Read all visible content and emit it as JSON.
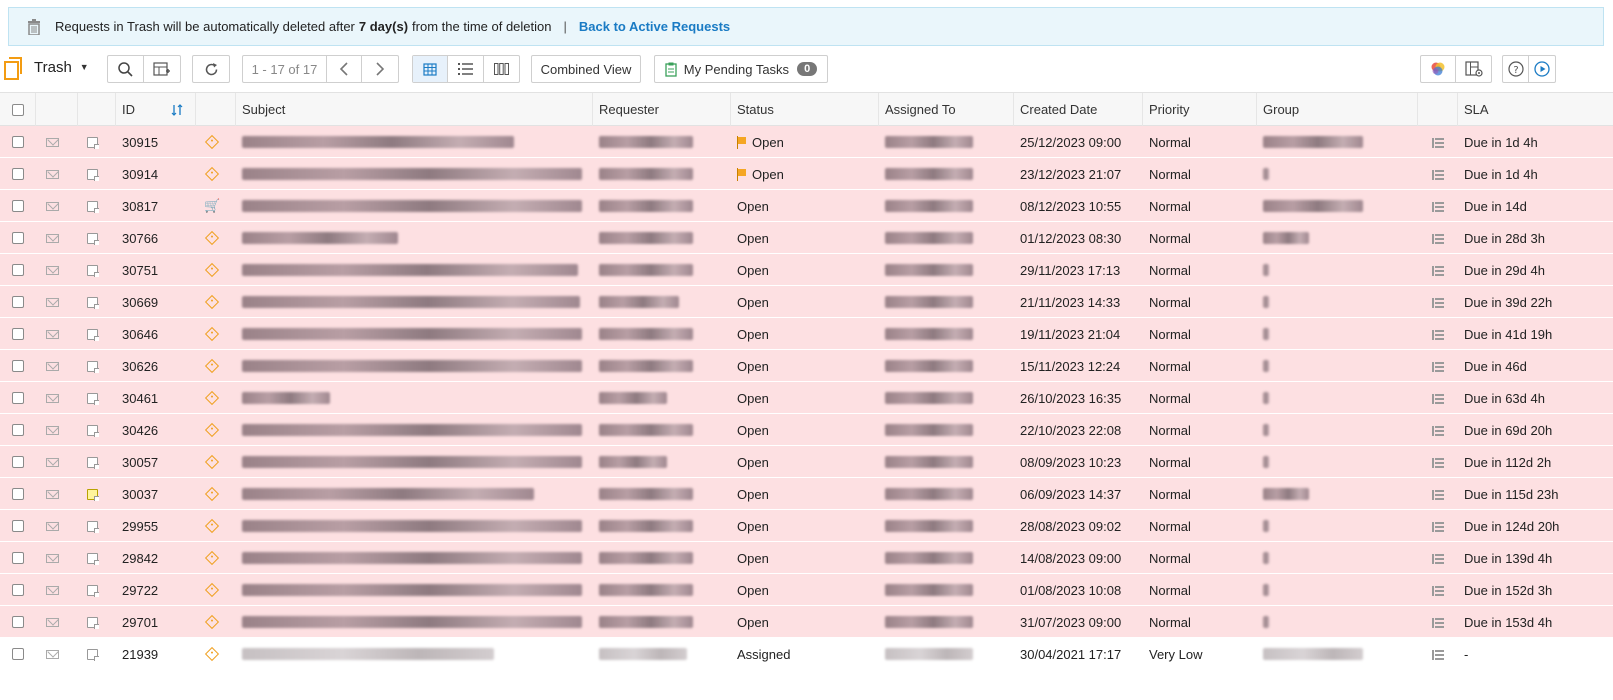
{
  "banner": {
    "prefix": "Requests in Trash will be automatically deleted after",
    "days": "7 day(s)",
    "suffix": "from the time of deletion",
    "separator": "|",
    "link": "Back to Active Requests"
  },
  "toolbar": {
    "view_name": "Trash",
    "pager": "1 - 17 of 17",
    "combined_view": "Combined View",
    "pending_tasks": "My Pending Tasks",
    "pending_count": "0"
  },
  "columns": {
    "id": "ID",
    "subject": "Subject",
    "requester": "Requester",
    "status": "Status",
    "assigned_to": "Assigned To",
    "created_date": "Created Date",
    "priority": "Priority",
    "group": "Group",
    "sla": "SLA"
  },
  "rows": [
    {
      "id": "30915",
      "status": "Open",
      "flag": true,
      "created": "25/12/2023 09:00",
      "priority": "Normal",
      "sla": "Due in 1d 4h",
      "icon": "tag",
      "note": "plain",
      "pink": true,
      "group": "wide"
    },
    {
      "id": "30914",
      "status": "Open",
      "flag": true,
      "created": "23/12/2023 21:07",
      "priority": "Normal",
      "sla": "Due in 1d 4h",
      "icon": "tag",
      "note": "plain",
      "pink": true,
      "group": "dot"
    },
    {
      "id": "30817",
      "status": "Open",
      "flag": false,
      "created": "08/12/2023 10:55",
      "priority": "Normal",
      "sla": "Due in 14d",
      "icon": "cart",
      "note": "plain",
      "pink": true,
      "group": "wide"
    },
    {
      "id": "30766",
      "status": "Open",
      "flag": false,
      "created": "01/12/2023 08:30",
      "priority": "Normal",
      "sla": "Due in 28d 3h",
      "icon": "tag",
      "note": "plain",
      "pink": true,
      "group": "short"
    },
    {
      "id": "30751",
      "status": "Open",
      "flag": false,
      "created": "29/11/2023 17:13",
      "priority": "Normal",
      "sla": "Due in 29d 4h",
      "icon": "tag",
      "note": "plain",
      "pink": true,
      "group": "dot"
    },
    {
      "id": "30669",
      "status": "Open",
      "flag": false,
      "created": "21/11/2023 14:33",
      "priority": "Normal",
      "sla": "Due in 39d 22h",
      "icon": "tag",
      "note": "plain",
      "pink": true,
      "group": "dot"
    },
    {
      "id": "30646",
      "status": "Open",
      "flag": false,
      "created": "19/11/2023 21:04",
      "priority": "Normal",
      "sla": "Due in 41d 19h",
      "icon": "tag",
      "note": "plain",
      "pink": true,
      "group": "dot"
    },
    {
      "id": "30626",
      "status": "Open",
      "flag": false,
      "created": "15/11/2023 12:24",
      "priority": "Normal",
      "sla": "Due in 46d",
      "icon": "tag",
      "note": "plain",
      "pink": true,
      "group": "dot"
    },
    {
      "id": "30461",
      "status": "Open",
      "flag": false,
      "created": "26/10/2023 16:35",
      "priority": "Normal",
      "sla": "Due in 63d 4h",
      "icon": "tag",
      "note": "plain",
      "pink": true,
      "group": "dot"
    },
    {
      "id": "30426",
      "status": "Open",
      "flag": false,
      "created": "22/10/2023 22:08",
      "priority": "Normal",
      "sla": "Due in 69d 20h",
      "icon": "tag",
      "note": "plain",
      "pink": true,
      "group": "dot"
    },
    {
      "id": "30057",
      "status": "Open",
      "flag": false,
      "created": "08/09/2023 10:23",
      "priority": "Normal",
      "sla": "Due in 112d 2h",
      "icon": "tag",
      "note": "plain",
      "pink": true,
      "group": "dot"
    },
    {
      "id": "30037",
      "status": "Open",
      "flag": false,
      "created": "06/09/2023 14:37",
      "priority": "Normal",
      "sla": "Due in 115d 23h",
      "icon": "tag",
      "note": "yellow",
      "pink": true,
      "group": "short"
    },
    {
      "id": "29955",
      "status": "Open",
      "flag": false,
      "created": "28/08/2023 09:02",
      "priority": "Normal",
      "sla": "Due in 124d 20h",
      "icon": "tag",
      "note": "plain",
      "pink": true,
      "group": "dot"
    },
    {
      "id": "29842",
      "status": "Open",
      "flag": false,
      "created": "14/08/2023 09:00",
      "priority": "Normal",
      "sla": "Due in 139d 4h",
      "icon": "tag",
      "note": "plain",
      "pink": true,
      "group": "dot"
    },
    {
      "id": "29722",
      "status": "Open",
      "flag": false,
      "created": "01/08/2023 10:08",
      "priority": "Normal",
      "sla": "Due in 152d 3h",
      "icon": "tag",
      "note": "plain",
      "pink": true,
      "group": "dot"
    },
    {
      "id": "29701",
      "status": "Open",
      "flag": false,
      "created": "31/07/2023 09:00",
      "priority": "Normal",
      "sla": "Due in 153d 4h",
      "icon": "tag",
      "note": "plain",
      "pink": true,
      "group": "dot"
    },
    {
      "id": "21939",
      "status": "Assigned",
      "flag": false,
      "created": "30/04/2021 17:17",
      "priority": "Very Low",
      "sla": "-",
      "icon": "tag",
      "note": "plain",
      "pink": false,
      "group": "wide"
    }
  ],
  "colors": {
    "overdue_row": "#fde0e2",
    "banner_bg": "#eaf6fb",
    "link": "#1a7bc4",
    "accent": "#f39c12"
  }
}
